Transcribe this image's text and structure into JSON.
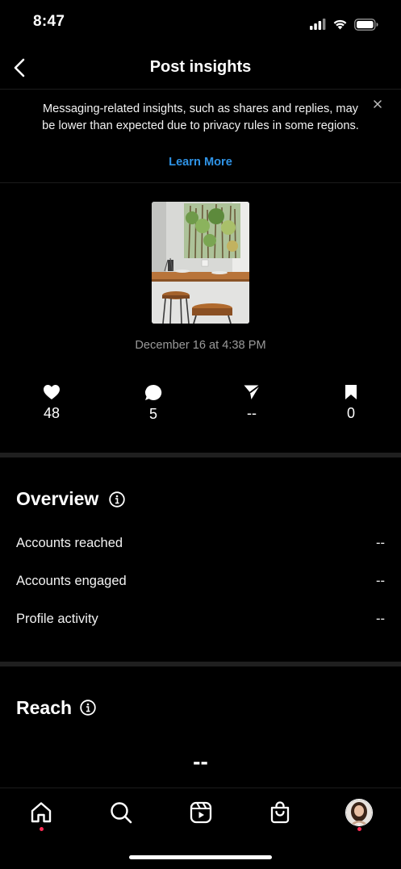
{
  "status_bar": {
    "time": "8:47"
  },
  "header": {
    "title": "Post insights"
  },
  "banner": {
    "message": "Messaging-related insights, such as shares and replies, may be lower than expected due to privacy rules in some regions.",
    "link": "Learn More"
  },
  "post": {
    "date": "December 16 at 4:38 PM"
  },
  "stats": {
    "likes": "48",
    "comments": "5",
    "shares": "--",
    "saves": "0"
  },
  "overview": {
    "title": "Overview",
    "rows": [
      {
        "label": "Accounts reached",
        "value": "--"
      },
      {
        "label": "Accounts engaged",
        "value": "--"
      },
      {
        "label": "Profile activity",
        "value": "--"
      }
    ]
  },
  "reach": {
    "title": "Reach",
    "value": "--"
  },
  "colors": {
    "background": "#000000",
    "link": "#2f93e6",
    "notification_dot": "#ff2d55"
  },
  "tabs": [
    "home-icon",
    "search-icon",
    "reels-icon",
    "shop-icon",
    "profile-avatar"
  ]
}
